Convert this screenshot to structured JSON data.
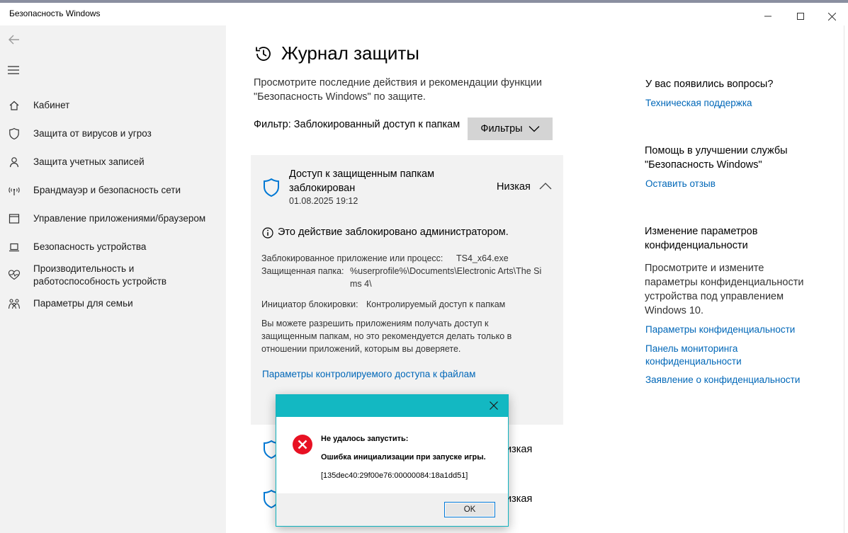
{
  "window": {
    "title": "Безопасность Windows"
  },
  "sidebar": {
    "items": [
      {
        "label": "Кабинет",
        "icon": "home-icon"
      },
      {
        "label": "Защита от вирусов и угроз",
        "icon": "shield-icon"
      },
      {
        "label": "Защита учетных записей",
        "icon": "person-icon"
      },
      {
        "label": "Брандмауэр и безопасность сети",
        "icon": "wifi-icon"
      },
      {
        "label": "Управление приложениями/браузером",
        "icon": "app-browser-icon"
      },
      {
        "label": "Безопасность устройства",
        "icon": "laptop-icon"
      },
      {
        "label": "Производительность и\nработоспособность устройств",
        "icon": "heart-pulse-icon"
      },
      {
        "label": "Параметры для семьи",
        "icon": "family-icon"
      }
    ]
  },
  "main": {
    "title": "Журнал защиты",
    "description": "Просмотрите последние действия и рекомендации функции \"Безопасность Windows\" по защите.",
    "filter_label": "Фильтр: Заблокированный доступ к папкам",
    "filter_button": "Фильтры",
    "card": {
      "title": "Доступ к защищенным папкам заблокирован",
      "date": "01.08.2025 19:12",
      "severity": "Низкая",
      "admin_notice": "Это действие заблокировано администратором.",
      "blocked_app_label": "Заблокированное приложение или процесс:",
      "blocked_app_value": "TS4_x64.exe",
      "folder_label": "Защищенная папка:",
      "folder_value": "%userprofile%\\Documents\\Electronic Arts\\The Sims 4\\",
      "initiator_label": "Инициатор блокировки:",
      "initiator_value": "Контролируемый доступ к папкам",
      "info": "Вы можете разрешить приложениям получать доступ к защищенным папкам, но это рекомендуется делать только в отношении приложений, которым вы доверяете.",
      "link": "Параметры контролируемого доступа к файлам"
    },
    "list_items": [
      {
        "severity": "изкая"
      },
      {
        "severity": "изкая"
      }
    ]
  },
  "right": {
    "questions_header": "У вас появились вопросы?",
    "support_link": "Техническая поддержка",
    "improve_header": "Помощь в улучшении службы \"Безопасность Windows\"",
    "feedback_link": "Оставить отзыв",
    "privacy_header": "Изменение параметров конфиденциальности",
    "privacy_text": "Просмотрите и измените параметры конфиденциальности устройства под управлением Windows 10.",
    "privacy_links": [
      "Параметры конфиденциальности",
      "Панель мониторинга конфиденциальности",
      "Заявление о конфиденциальности"
    ]
  },
  "dialog": {
    "line1": "Не удалось запустить:",
    "line2": "Ошибка инициализации при запуске игры.",
    "code": "[135dec40:29f00e76:00000084:18a1dd51]",
    "ok": "OK"
  },
  "colors": {
    "link": "#0067b8",
    "dialog_title": "#13b8c2",
    "error": "#e81123"
  }
}
